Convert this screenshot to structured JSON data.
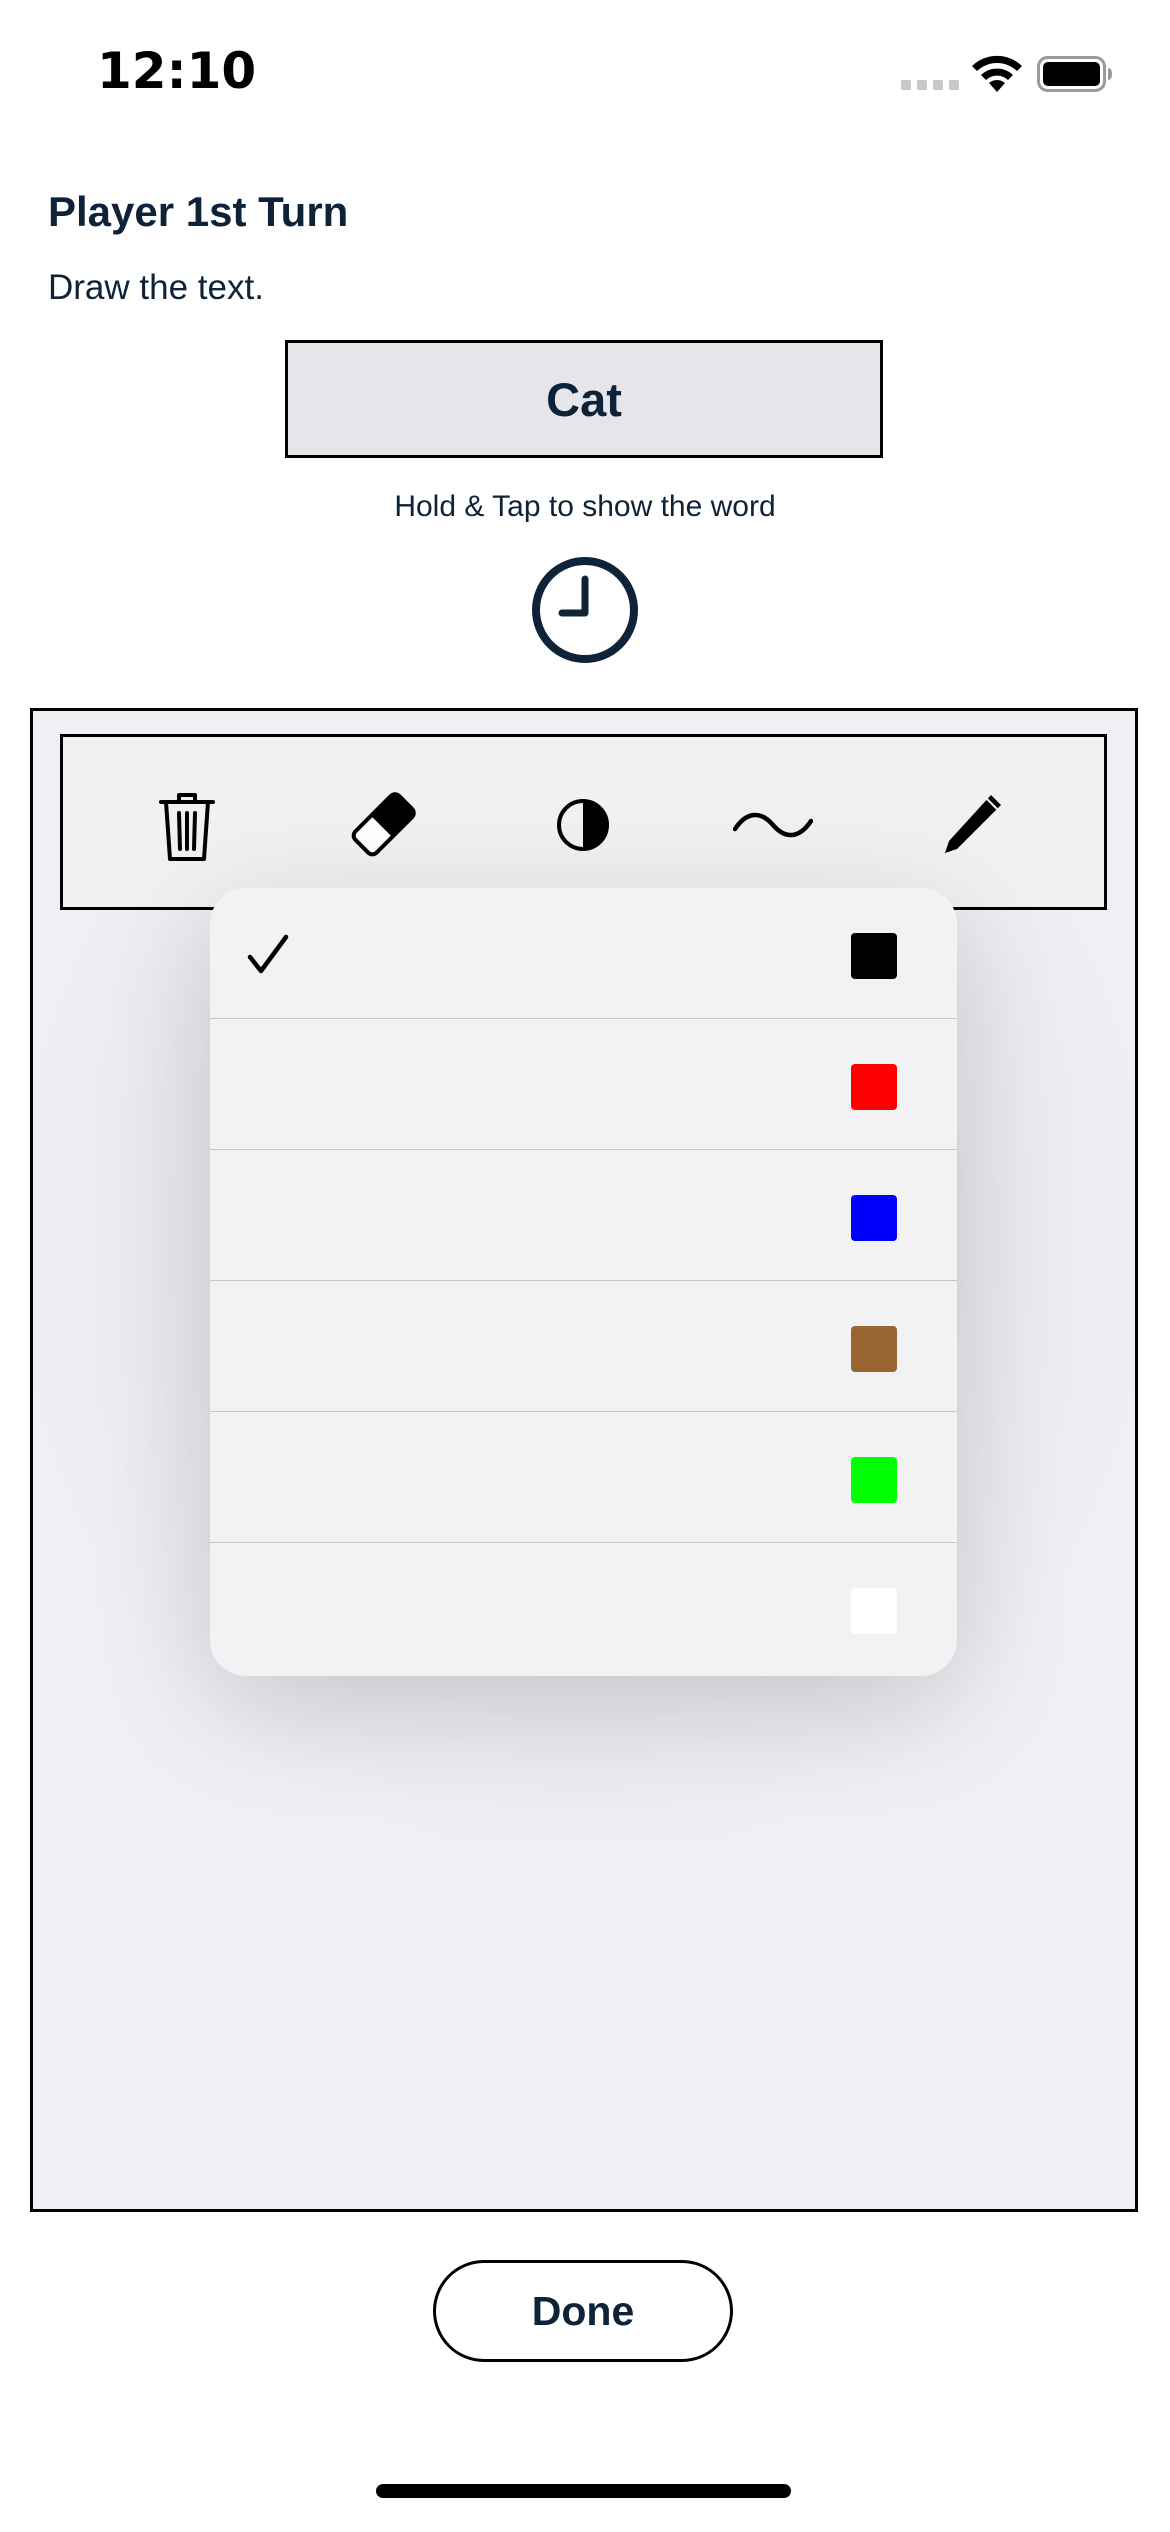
{
  "status_bar": {
    "time": "12:10",
    "icons": [
      "cellular-signal-icon",
      "wifi-icon",
      "battery-icon"
    ]
  },
  "header": {
    "title": "Player 1st Turn",
    "subtitle": "Draw the text."
  },
  "word_card": {
    "word": "Cat",
    "hint": "Hold & Tap to show the word"
  },
  "timer": {
    "icon": "clock-icon"
  },
  "toolbar": {
    "tools": [
      {
        "name": "clear",
        "icon": "trash-icon"
      },
      {
        "name": "eraser",
        "icon": "eraser-icon"
      },
      {
        "name": "color",
        "icon": "contrast-icon"
      },
      {
        "name": "stroke",
        "icon": "tilde-wave-icon"
      },
      {
        "name": "pencil",
        "icon": "pencil-icon"
      }
    ]
  },
  "color_menu": {
    "selected_index": 0,
    "options": [
      {
        "name": "black",
        "color": "#000000",
        "selected": true
      },
      {
        "name": "red",
        "color": "#ff0000",
        "selected": false
      },
      {
        "name": "blue",
        "color": "#0000ff",
        "selected": false
      },
      {
        "name": "brown",
        "color": "#996633",
        "selected": false
      },
      {
        "name": "green",
        "color": "#00ff00",
        "selected": false
      },
      {
        "name": "white",
        "color": "#ffffff",
        "selected": false
      }
    ]
  },
  "footer": {
    "done_label": "Done"
  }
}
